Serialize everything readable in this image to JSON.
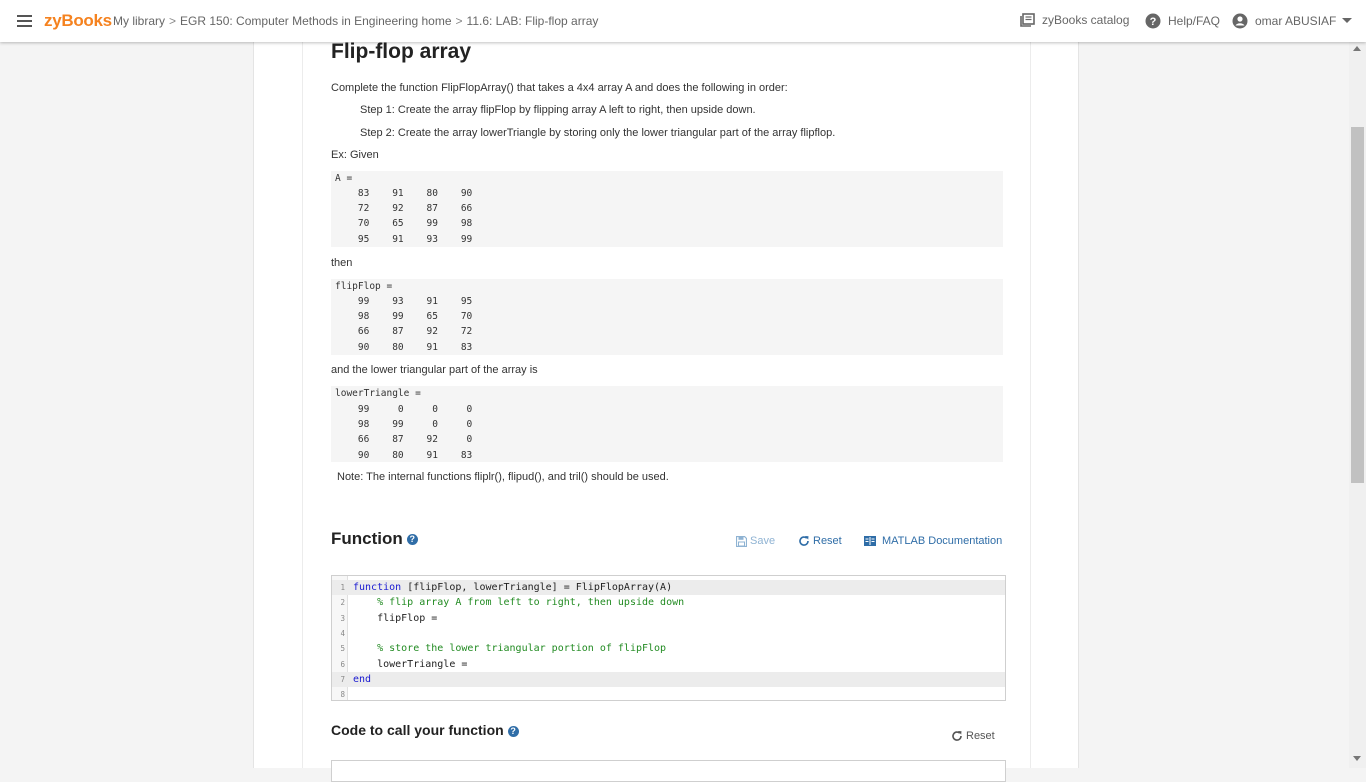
{
  "header": {
    "logo": "zyBooks",
    "breadcrumb": [
      "My library",
      "EGR 150: Computer Methods in Engineering home",
      "11.6: LAB: Flip-flop array"
    ],
    "breadcrumb_sep": ">",
    "catalog": "zyBooks catalog",
    "help": "Help/FAQ",
    "user": "omar ABUSIAF"
  },
  "main": {
    "title": "Flip-flop array",
    "intro": "Complete the function FlipFlopArray() that takes a 4x4 array A and does the following in order:",
    "step1": "Step 1: Create the array flipFlop by flipping array A left to right, then upside down.",
    "step2": "Step 2: Create the array lowerTriangle by storing only the lower triangular part of the array flipflop.",
    "given": "Ex: Given",
    "then": "then",
    "lower_intro": "and the lower triangular part of the array is",
    "note": "Note: The internal functions fliplr(), flipud(), and tril() should be used.",
    "block_a": {
      "lines": [
        "A =",
        "    83    91    80    90",
        "    72    92    87    66",
        "    70    65    99    98",
        "    95    91    93    99"
      ]
    },
    "block_flip": {
      "lines": [
        "flipFlop =",
        "    99    93    91    95",
        "    98    99    65    70",
        "    66    87    92    72",
        "    90    80    91    83"
      ]
    },
    "block_lower": {
      "lines": [
        "lowerTriangle =",
        "    99     0     0     0",
        "    98    99     0     0",
        "    66    87    92     0",
        "    90    80    91    83"
      ]
    }
  },
  "function_section": {
    "heading": "Function",
    "help_glyph": "?",
    "save": "Save",
    "reset": "Reset",
    "docs": "MATLAB Documentation",
    "code_lines": [
      {
        "n": "1",
        "parts": [
          {
            "t": "function",
            "c": "kw"
          },
          {
            "t": " [flipFlop, lowerTriangle] = FlipFlopArray(A)",
            "c": ""
          }
        ]
      },
      {
        "n": "2",
        "parts": [
          {
            "t": "    % flip array A from left to right, then upside down",
            "c": "cm"
          }
        ]
      },
      {
        "n": "3",
        "parts": [
          {
            "t": "    flipFlop =",
            "c": ""
          }
        ]
      },
      {
        "n": "4",
        "parts": [
          {
            "t": "",
            "c": ""
          }
        ]
      },
      {
        "n": "5",
        "parts": [
          {
            "t": "    % store the lower triangular portion of flipFlop",
            "c": "cm"
          }
        ]
      },
      {
        "n": "6",
        "parts": [
          {
            "t": "    lowerTriangle =",
            "c": ""
          }
        ]
      },
      {
        "n": "7",
        "parts": [
          {
            "t": "end",
            "c": "kw"
          }
        ]
      },
      {
        "n": "8",
        "parts": [
          {
            "t": "",
            "c": ""
          }
        ]
      }
    ]
  },
  "call_section": {
    "heading": "Code to call your function",
    "help_glyph": "?",
    "reset": "Reset"
  },
  "colors": {
    "brand": "#f5821f",
    "link": "#2f6da7",
    "save_disabled": "#8fb3d3"
  }
}
